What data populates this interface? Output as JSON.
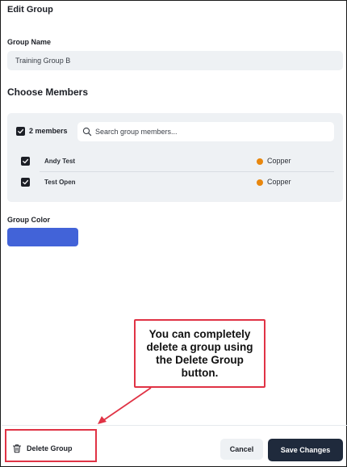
{
  "dialog": {
    "title": "Edit Group"
  },
  "group_name": {
    "label": "Group Name",
    "value": "Training Group B"
  },
  "members": {
    "title": "Choose Members",
    "selected_count_label": "2 members",
    "search_placeholder": "Search group members...",
    "list": [
      {
        "name": "Andy Test",
        "role": "Copper",
        "checked": true
      },
      {
        "name": "Test Open",
        "role": "Copper",
        "checked": true
      }
    ],
    "role_dot_color": "#e8870e"
  },
  "group_color": {
    "label": "Group Color",
    "value": "#4263d8"
  },
  "callout": {
    "text": "You can completely delete a group using the Delete Group button."
  },
  "footer": {
    "delete_label": "Delete Group",
    "cancel_label": "Cancel",
    "save_label": "Save Changes"
  },
  "colors": {
    "annotation_red": "#e03345",
    "primary_dark": "#1f2a3c"
  }
}
